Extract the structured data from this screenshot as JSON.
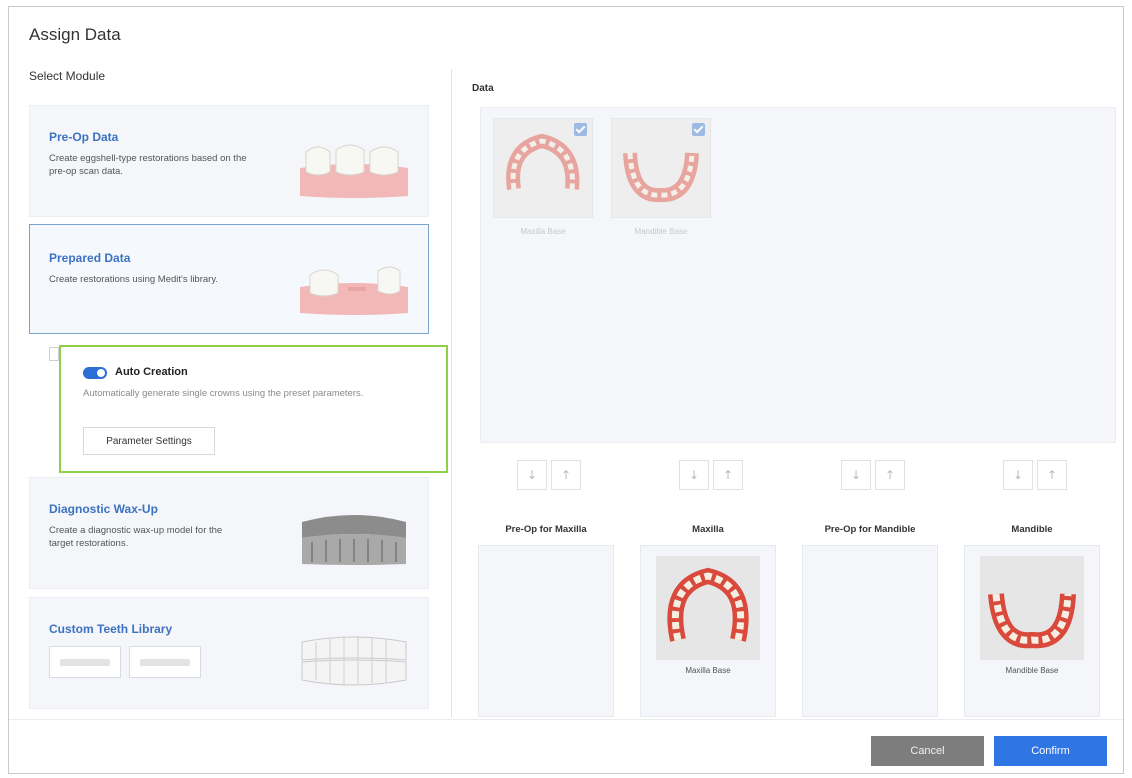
{
  "dialog": {
    "title": "Assign Data"
  },
  "left": {
    "section_label": "Select Module",
    "modules": [
      {
        "title": "Pre-Op Data",
        "desc": "Create eggshell-type restorations based on the pre-op scan data.",
        "icon": "pre-op-teeth-illustration"
      },
      {
        "title": "Prepared Data",
        "desc": "Create restorations using Medit's library.",
        "icon": "prepared-teeth-illustration",
        "selected": true
      },
      {
        "title": "Diagnostic Wax-Up",
        "desc": "Create a diagnostic wax-up model for the target restorations.",
        "icon": "wax-up-model-illustration"
      },
      {
        "title": "Custom Teeth Library",
        "desc": "",
        "icon": "teeth-library-illustration"
      }
    ],
    "auto_creation": {
      "label": "Auto Creation",
      "enabled": true,
      "desc": "Automatically generate single crowns using the preset parameters.",
      "button": "Parameter Settings"
    }
  },
  "right": {
    "section_label": "Data",
    "thumbnails": [
      {
        "label": "Maxilla Base",
        "checked": true
      },
      {
        "label": "Mandible Base",
        "checked": true
      }
    ],
    "arrow_down": "↓",
    "arrow_up": "↑",
    "slots": [
      {
        "label": "Pre-Op for Maxilla",
        "item": ""
      },
      {
        "label": "Maxilla",
        "item": "Maxilla Base"
      },
      {
        "label": "Pre-Op for Mandible",
        "item": ""
      },
      {
        "label": "Mandible",
        "item": "Mandible Base"
      }
    ]
  },
  "footer": {
    "cancel": "Cancel",
    "confirm": "Confirm"
  },
  "colors": {
    "accent": "#2f76e4",
    "highlight": "#8fcf4a",
    "link": "#3c72c2",
    "cancel": "#7d7d7d"
  }
}
